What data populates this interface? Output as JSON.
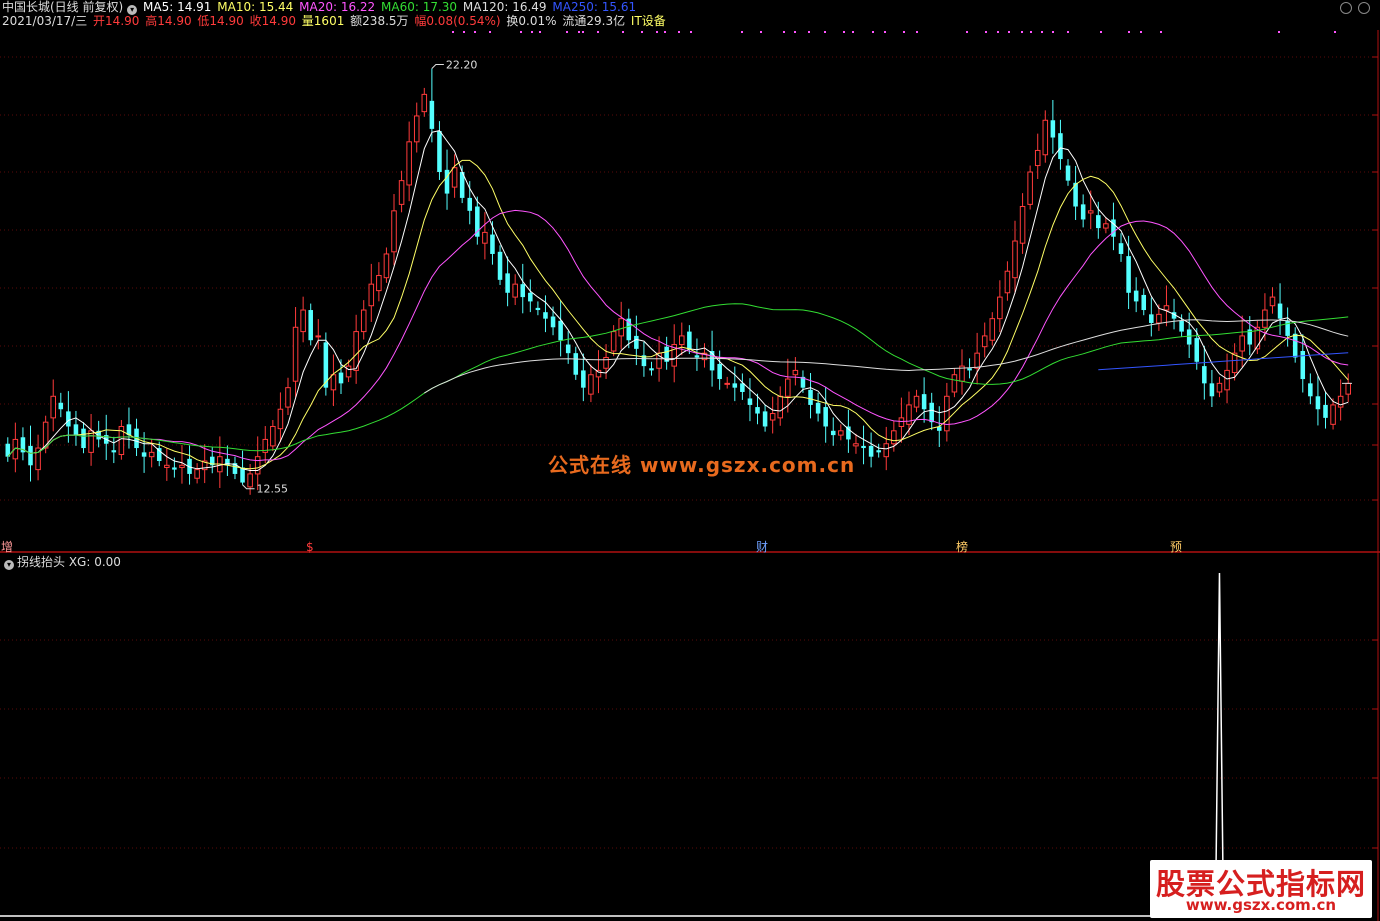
{
  "header": {
    "stock_name": "中国长城(日线 前复权)",
    "ma": [
      {
        "label": "MA5: 14.91",
        "color": "#ffffff"
      },
      {
        "label": "MA10: 15.44",
        "color": "#ffff66"
      },
      {
        "label": "MA20: 16.22",
        "color": "#ff55ff"
      },
      {
        "label": "MA60: 17.30",
        "color": "#33dd33"
      },
      {
        "label": "MA120: 16.49",
        "color": "#dddddd"
      },
      {
        "label": "MA250: 15.61",
        "color": "#3355ff"
      }
    ],
    "quote": [
      {
        "label": "2021/03/17/三",
        "color": "#dddddd"
      },
      {
        "label": "开14.90",
        "color": "#ff3b3b"
      },
      {
        "label": "高14.90",
        "color": "#ff3b3b"
      },
      {
        "label": "低14.90",
        "color": "#ff3b3b"
      },
      {
        "label": "收14.90",
        "color": "#ff3b3b"
      },
      {
        "label": "量1601",
        "color": "#ffff66"
      },
      {
        "label": "额238.5万",
        "color": "#dddddd"
      },
      {
        "label": "幅0.08(0.54%)",
        "color": "#ff3b3b"
      },
      {
        "label": "换0.01%",
        "color": "#dddddd"
      },
      {
        "label": "流通29.3亿",
        "color": "#dddddd"
      },
      {
        "label": "IT设备",
        "color": "#ffff66"
      }
    ]
  },
  "chart_data": [
    {
      "type": "candlestick",
      "title": "",
      "ylim": [
        11.5,
        23.0
      ],
      "high_label": "22.20",
      "low_label": "12.55",
      "colors": {
        "up": "#ff3b3b",
        "down": "#54ffff",
        "ma5": "#ffffff",
        "ma10": "#ffff66",
        "ma20": "#ff55ff",
        "ma60": "#33dd33",
        "ma120": "#dddddd",
        "ma250": "#3355ff"
      },
      "closes": [
        13.2,
        13.6,
        13.3,
        13.0,
        13.4,
        14.0,
        14.6,
        14.3,
        13.9,
        13.7,
        13.4,
        13.8,
        13.6,
        13.5,
        13.3,
        13.9,
        13.7,
        13.4,
        13.2,
        13.3,
        13.1,
        13.0,
        12.9,
        13.0,
        12.8,
        12.9,
        13.1,
        13.0,
        13.2,
        13.0,
        12.8,
        12.6,
        12.8,
        13.2,
        13.6,
        13.9,
        14.3,
        14.8,
        16.2,
        16.6,
        15.9,
        16.0,
        14.8,
        15.1,
        14.9,
        15.3,
        16.1,
        16.6,
        17.2,
        17.4,
        17.9,
        18.9,
        19.6,
        20.5,
        21.1,
        21.6,
        20.8,
        19.8,
        19.3,
        19.9,
        19.2,
        18.9,
        18.3,
        18.4,
        17.9,
        17.3,
        17.0,
        17.2,
        16.9,
        16.8,
        16.6,
        16.4,
        16.2,
        15.9,
        15.6,
        15.1,
        14.8,
        15.1,
        15.2,
        15.5,
        16.1,
        16.4,
        15.9,
        15.7,
        15.3,
        15.2,
        15.6,
        15.4,
        15.8,
        16.0,
        15.7,
        15.5,
        15.6,
        15.2,
        15.0,
        14.9,
        14.8,
        14.7,
        14.4,
        14.2,
        13.9,
        14.2,
        14.6,
        15.0,
        15.2,
        14.8,
        14.4,
        14.2,
        13.9,
        13.7,
        13.8,
        13.6,
        13.5,
        13.4,
        13.2,
        13.3,
        13.5,
        13.8,
        14.1,
        14.4,
        14.6,
        14.3,
        14.0,
        13.8,
        14.6,
        15.1,
        15.3,
        15.2,
        15.6,
        16.0,
        16.4,
        16.9,
        17.5,
        18.2,
        19.0,
        19.8,
        20.3,
        21.0,
        20.6,
        20.1,
        19.6,
        19.0,
        18.7,
        18.9,
        18.5,
        18.6,
        18.3,
        17.9,
        17.0,
        16.8,
        16.6,
        16.3,
        16.5,
        16.7,
        16.4,
        16.1,
        15.8,
        15.4,
        14.9,
        14.6,
        14.9,
        15.2,
        15.6,
        16.0,
        15.8,
        16.2,
        16.6,
        16.9,
        16.4,
        16.0,
        15.5,
        15.0,
        14.6,
        14.3,
        14.1,
        14.4,
        14.6,
        14.9
      ],
      "ma5_last": 14.91,
      "ma10_last": 15.44,
      "ma20_last": 16.22,
      "ma60_last": 17.3,
      "ma120_last": 16.49,
      "ma250_last": 15.61,
      "event_markers": [
        {
          "label": "增",
          "color": "#ff9a9a"
        },
        {
          "label": "$",
          "color": "#ff3b3b"
        },
        {
          "label": "财",
          "color": "#6fa0ff"
        },
        {
          "label": "榜",
          "color": "#ffcc66"
        },
        {
          "label": "预",
          "color": "#ffcc66"
        }
      ],
      "watermark": "公式在线  www.gszx.com.cn"
    },
    {
      "type": "line",
      "title": "拐线抬头 XG: 0.00",
      "series_color": "#ffffff",
      "spike_value": 1,
      "baseline": 0
    }
  ],
  "logo": {
    "line1": "股票公式指标网",
    "line2": "www.gszx.com.cn"
  }
}
